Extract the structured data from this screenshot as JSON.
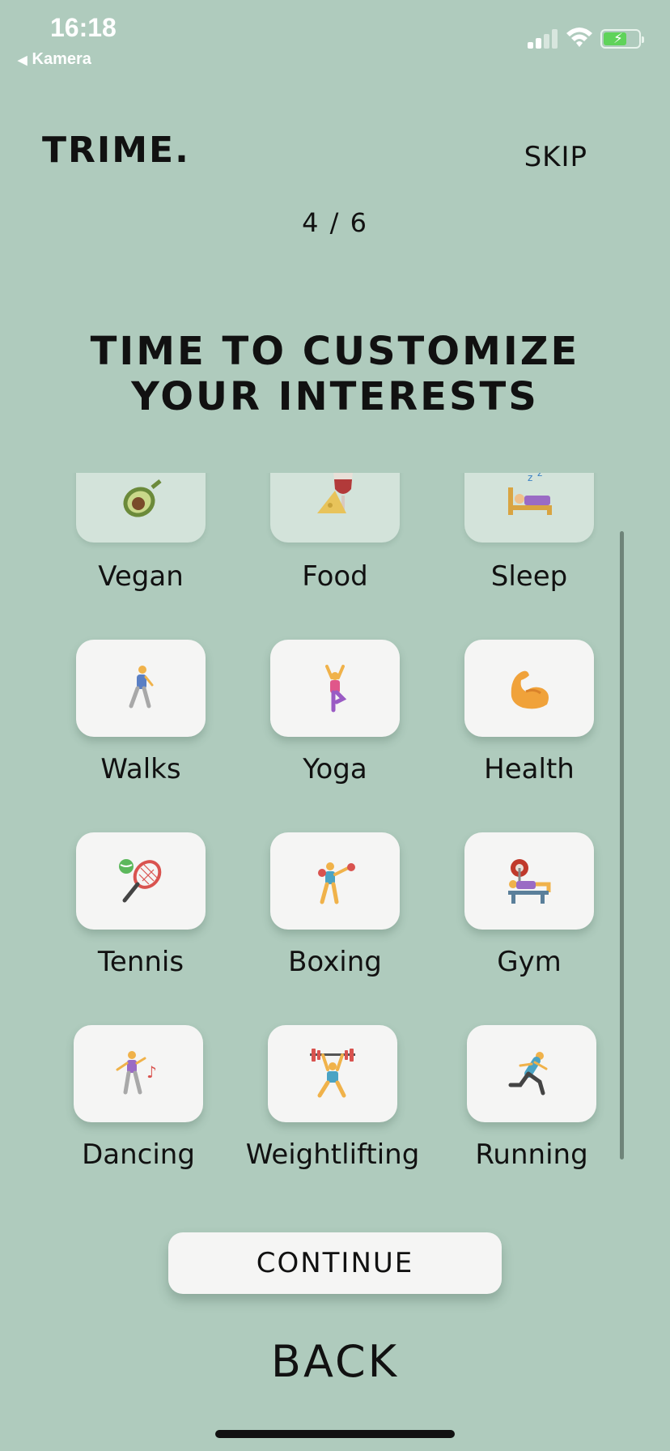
{
  "status": {
    "time": "16:18",
    "back_app": "Kamera"
  },
  "header": {
    "logo": "TRIME.",
    "skip_label": "SKIP",
    "progress": "4 / 6"
  },
  "title": {
    "line1": "TIME TO CUSTOMIZE",
    "line2": "YOUR INTERESTS"
  },
  "interests": [
    {
      "label": "Vegan",
      "icon": "avocado-icon"
    },
    {
      "label": "Food",
      "icon": "wine-cheese-icon"
    },
    {
      "label": "Sleep",
      "icon": "bed-sleep-icon"
    },
    {
      "label": "Walks",
      "icon": "walking-person-icon"
    },
    {
      "label": "Yoga",
      "icon": "yoga-pose-icon"
    },
    {
      "label": "Health",
      "icon": "flexed-bicep-icon"
    },
    {
      "label": "Tennis",
      "icon": "tennis-racket-icon"
    },
    {
      "label": "Boxing",
      "icon": "boxer-icon"
    },
    {
      "label": "Gym",
      "icon": "bench-press-icon"
    },
    {
      "label": "Dancing",
      "icon": "dancer-icon"
    },
    {
      "label": "Weightlifting",
      "icon": "weightlifter-icon"
    },
    {
      "label": "Running",
      "icon": "runner-icon"
    }
  ],
  "actions": {
    "continue_label": "CONTINUE",
    "back_label": "BACK"
  },
  "colors": {
    "background": "#afcbbd",
    "tile": "#f5f5f4",
    "text": "#111111"
  }
}
